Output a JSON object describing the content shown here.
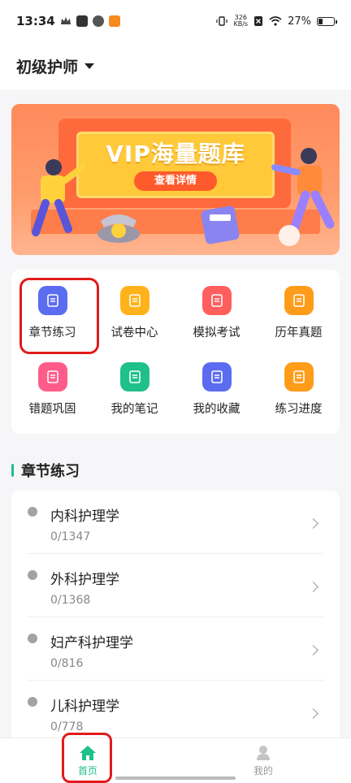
{
  "status_bar": {
    "time": "13:34",
    "net_speed_value": "326",
    "net_speed_unit": "KB/s",
    "battery": "27%",
    "battery_level": 0.27
  },
  "header": {
    "title": "初级护师"
  },
  "banner": {
    "title": "VIP海量题库",
    "button": "查看详情"
  },
  "grid": {
    "items": [
      {
        "label": "章节练习",
        "icon": "chapter-icon",
        "color": "#5b6cf0"
      },
      {
        "label": "试卷中心",
        "icon": "paper-icon",
        "color": "#ffb21a"
      },
      {
        "label": "模拟考试",
        "icon": "mock-exam-icon",
        "color": "#ff5e5e"
      },
      {
        "label": "历年真题",
        "icon": "book-icon",
        "color": "#ff9c1a"
      },
      {
        "label": "错题巩固",
        "icon": "wrong-question-icon",
        "color": "#ff5c8a"
      },
      {
        "label": "我的笔记",
        "icon": "note-icon",
        "color": "#1fc089"
      },
      {
        "label": "我的收藏",
        "icon": "star-folder-icon",
        "color": "#5b6cf0"
      },
      {
        "label": "练习进度",
        "icon": "progress-icon",
        "color": "#ff9c1a"
      }
    ]
  },
  "section": {
    "title": "章节练习"
  },
  "chapters": [
    {
      "name": "内科护理学",
      "progress": "0/1347"
    },
    {
      "name": "外科护理学",
      "progress": "0/1368"
    },
    {
      "name": "妇产科护理学",
      "progress": "0/816"
    },
    {
      "name": "儿科护理学",
      "progress": "0/778"
    }
  ],
  "bottom_nav": {
    "home": "首页",
    "mine": "我的"
  },
  "colors": {
    "accent": "#1fc089",
    "highlight": "#e11b1b"
  }
}
